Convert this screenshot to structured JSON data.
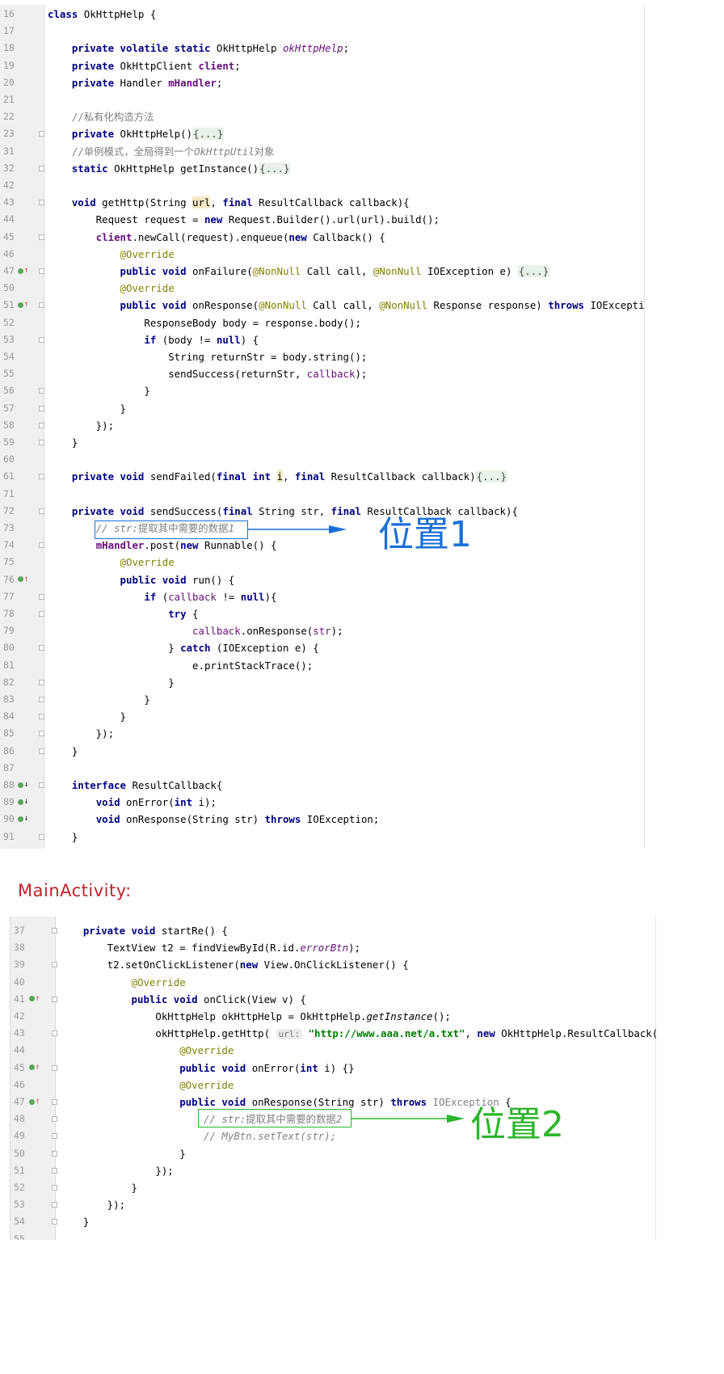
{
  "editor1": {
    "lines": [
      {
        "n": "16",
        "html": "<span class=\"kw\">class</span> OkHttpHelp {"
      },
      {
        "n": "17",
        "html": ""
      },
      {
        "n": "18",
        "html": "    <span class=\"kw\">private volatile static</span> OkHttpHelp <span class=\"fdi\">okHttpHelp</span>;"
      },
      {
        "n": "19",
        "html": "    <span class=\"kw\">private</span> OkHttpClient <span class=\"fd\">client</span>;"
      },
      {
        "n": "20",
        "html": "    <span class=\"kw\">private</span> Handler <span class=\"fd\">mHandler</span>;"
      },
      {
        "n": "21",
        "html": ""
      },
      {
        "n": "22",
        "html": "    <span class=\"cmn\">//私有化构造方法</span>"
      },
      {
        "n": "23",
        "html": "    <span class=\"kw\">private</span> OkHttpHelp()<span class=\"fold-box\">{...}</span>"
      },
      {
        "n": "31",
        "html": "    <span class=\"cmn\">//单例模式，全局得到一个</span><span class=\"cm\">OkHttpUtil</span><span class=\"cmn\">对象</span>"
      },
      {
        "n": "32",
        "html": "    <span class=\"kw\">static</span> OkHttpHelp getInstance()<span class=\"fold-box\">{...}</span>"
      },
      {
        "n": "42",
        "html": ""
      },
      {
        "n": "43",
        "html": "    <span class=\"kw\">void</span> getHttp(String <span class=\"hl\">url</span>, <span class=\"kw\">final</span> ResultCallback callback){"
      },
      {
        "n": "44",
        "html": "        Request request = <span class=\"kw\">new</span> Request.Builder().url(url).build();"
      },
      {
        "n": "45",
        "html": "        <span class=\"fd\">client</span>.newCall(request).enqueue(<span class=\"kw\">new</span> Callback() {"
      },
      {
        "n": "46",
        "html": "            <span class=\"an\">@Override</span>"
      },
      {
        "n": "47",
        "html": "            <span class=\"kw\">public void</span> onFailure(<span class=\"an\">@NonNull</span> Call call, <span class=\"an\">@NonNull</span> IOException e) <span class=\"fold-box\">{...}</span>"
      },
      {
        "n": "50",
        "html": "            <span class=\"an\">@Override</span>"
      },
      {
        "n": "51",
        "html": "            <span class=\"kw\">public void</span> onResponse(<span class=\"an\">@NonNull</span> Call call, <span class=\"an\">@NonNull</span> Response response) <span class=\"kw\">throws</span> IOException {"
      },
      {
        "n": "52",
        "html": "                ResponseBody body = response.body();"
      },
      {
        "n": "53",
        "html": "                <span class=\"kw\">if</span> (body != <span class=\"kw\">null</span>) {"
      },
      {
        "n": "54",
        "html": "                    String returnStr = body.string();"
      },
      {
        "n": "55",
        "html": "                    sendSuccess(returnStr, <span class=\"pm\">callback</span>);"
      },
      {
        "n": "56",
        "html": "                }"
      },
      {
        "n": "57",
        "html": "            }"
      },
      {
        "n": "58",
        "html": "        });"
      },
      {
        "n": "59",
        "html": "    }"
      },
      {
        "n": "60",
        "html": ""
      },
      {
        "n": "61",
        "html": "    <span class=\"kw\">private void</span> sendFailed(<span class=\"kw\">final int</span> <span class=\"hl\">i</span>, <span class=\"kw\">final</span> ResultCallback callback)<span class=\"fold-box\">{...}</span>"
      },
      {
        "n": "71",
        "html": ""
      },
      {
        "n": "72",
        "html": "    <span class=\"kw\">private void</span> sendSuccess(<span class=\"kw\">final</span> String str, <span class=\"kw\">final</span> ResultCallback callback){"
      },
      {
        "n": "73",
        "html": "        <span class=\"cm\">// str:</span><span class=\"cmn\">提取其中需要的数据</span><span class=\"cm\">1</span>"
      },
      {
        "n": "74",
        "html": "        <span class=\"fd\">mHandler</span>.post(<span class=\"kw\">new</span> Runnable() {"
      },
      {
        "n": "75",
        "html": "            <span class=\"an\">@Override</span>"
      },
      {
        "n": "76",
        "html": "            <span class=\"kw\">public void</span> run() {"
      },
      {
        "n": "77",
        "html": "                <span class=\"kw\">if</span> (<span class=\"pm\">callback</span> != <span class=\"kw\">null</span>){"
      },
      {
        "n": "78",
        "html": "                    <span class=\"kw\">try</span> {"
      },
      {
        "n": "79",
        "html": "                        <span class=\"pm\">callback</span>.onResponse(<span class=\"pm\">str</span>);"
      },
      {
        "n": "80",
        "html": "                    } <span class=\"kw\">catch</span> (IOException e) {"
      },
      {
        "n": "81",
        "html": "                        e.printStackTrace();"
      },
      {
        "n": "82",
        "html": "                    }"
      },
      {
        "n": "83",
        "html": "                }"
      },
      {
        "n": "84",
        "html": "            }"
      },
      {
        "n": "85",
        "html": "        });"
      },
      {
        "n": "86",
        "html": "    }"
      },
      {
        "n": "87",
        "html": ""
      },
      {
        "n": "88",
        "html": "    <span class=\"kw\">interface</span> ResultCallback{"
      },
      {
        "n": "89",
        "html": "        <span class=\"kw\">void</span> onError(<span class=\"kw\">int</span> i);"
      },
      {
        "n": "90",
        "html": "        <span class=\"kw\">void</span> onResponse(String str) <span class=\"kw\">throws</span> IOException;"
      },
      {
        "n": "91",
        "html": "    }"
      }
    ]
  },
  "editor2": {
    "lines": [
      {
        "n": "37",
        "html": "    <span class=\"kw\">private void</span> startRe() {"
      },
      {
        "n": "38",
        "html": "        TextView t2 = findViewById(R.id.<span class=\"fdi\">errorBtn</span>);"
      },
      {
        "n": "39",
        "html": "        t2.setOnClickListener(<span class=\"kw\">new</span> View.OnClickListener() {"
      },
      {
        "n": "40",
        "html": "            <span class=\"an\">@Override</span>"
      },
      {
        "n": "41",
        "html": "            <span class=\"kw\">public void</span> onClick(View v) {"
      },
      {
        "n": "42",
        "html": "                OkHttpHelp okHttpHelp = OkHttpHelp.<span class=\"it\">getInstance</span>();"
      },
      {
        "n": "43",
        "html": "                okHttpHelp.getHttp( <span class=\"hint\">url:</span> <span class=\"st\">\"http://www.aaa.net/a.txt\"</span>, <span class=\"kw\">new</span> OkHttpHelp.ResultCallback() {"
      },
      {
        "n": "44",
        "html": "                    <span class=\"an\">@Override</span>"
      },
      {
        "n": "45",
        "html": "                    <span class=\"kw\">public void</span> onError(<span class=\"kw\">int</span> i) {}"
      },
      {
        "n": "46",
        "html": "                    <span class=\"an\">@Override</span>"
      },
      {
        "n": "47",
        "html": "                    <span class=\"kw\">public void</span> onResponse(String str) <span class=\"kw\">throws</span> <span class=\"gray\">IOException</span> {"
      },
      {
        "n": "48",
        "html": "                        <span class=\"cm\">// str:</span><span class=\"cmn\">提取其中需要的数据</span><span class=\"cm\">2</span>"
      },
      {
        "n": "49",
        "html": "                        <span class=\"cm\">// MyBtn.setText(str);</span>"
      },
      {
        "n": "50",
        "html": "                    }"
      },
      {
        "n": "51",
        "html": "                });"
      },
      {
        "n": "52",
        "html": "            }"
      },
      {
        "n": "53",
        "html": "        });"
      },
      {
        "n": "54",
        "html": "    }"
      },
      {
        "n": "55",
        "html": ""
      }
    ]
  },
  "labels": {
    "section_title": "MainActivity:",
    "callout1": "位置1",
    "callout2": "位置2"
  },
  "colors": {
    "callout1": "#1a6fd6",
    "callout2": "#2bb52b",
    "section_title": "#c0232b"
  }
}
